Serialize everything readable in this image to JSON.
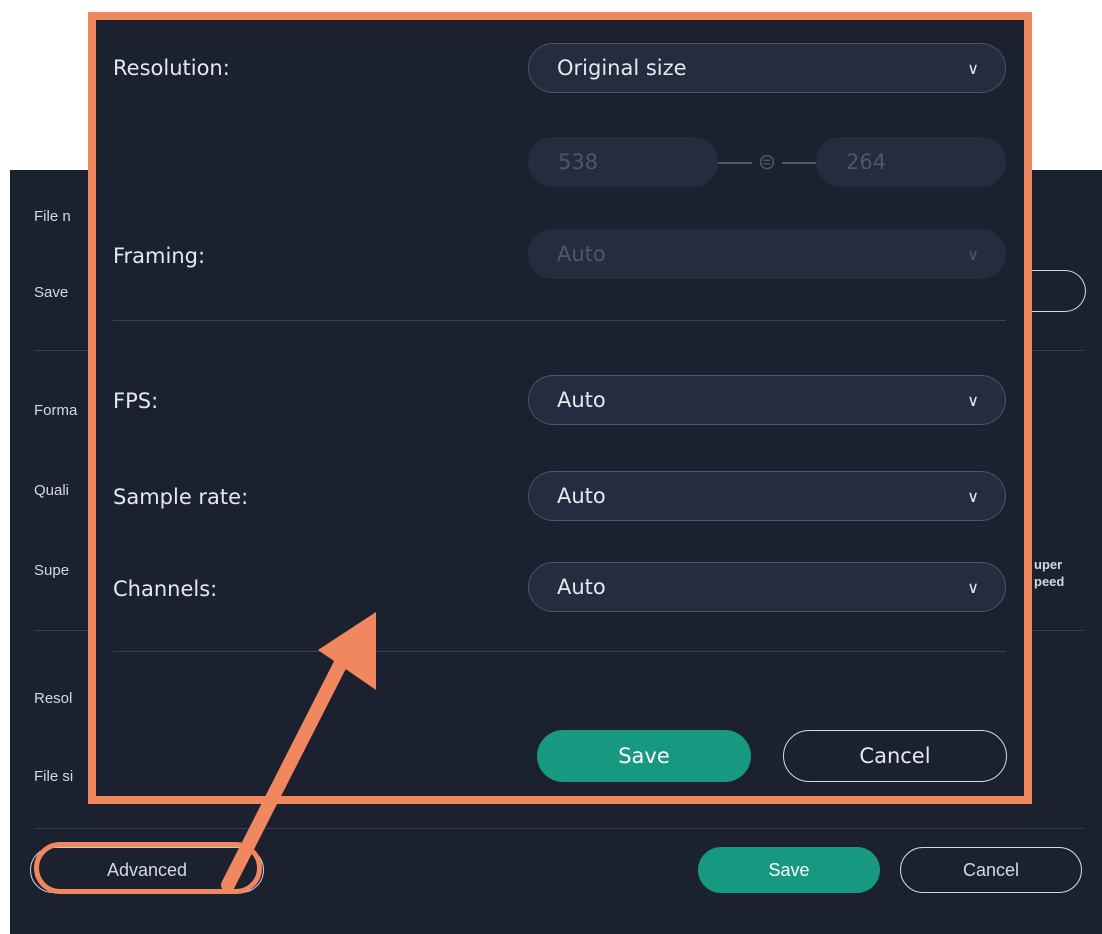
{
  "background": {
    "labels": {
      "file_name": "File n",
      "save": "Save",
      "format": "Forma",
      "quality": "Quali",
      "super": "Supe",
      "resolution": "Resol",
      "file_size": "File si"
    },
    "super_speed": [
      "uper",
      "peed"
    ],
    "save_label": "Save",
    "cancel_label": "Cancel",
    "advanced_label": "Advanced"
  },
  "popup": {
    "resolution": {
      "label": "Resolution:",
      "value": "Original size"
    },
    "width_value": "538",
    "height_value": "264",
    "framing": {
      "label": "Framing:",
      "value": "Auto"
    },
    "fps": {
      "label": "FPS:",
      "value": "Auto"
    },
    "sample_rate": {
      "label": "Sample rate:",
      "value": "Auto"
    },
    "channels": {
      "label": "Channels:",
      "value": "Auto"
    },
    "save_label": "Save",
    "cancel_label": "Cancel"
  },
  "colors": {
    "panel_bg": "#1c2130",
    "field_bg": "#262c3f",
    "accent_green": "#179881",
    "highlight_orange": "#f0875f",
    "text": "#e6e8ee",
    "disabled_text": "#4e566c"
  },
  "icons": {
    "dropdown": "chevron-down-icon",
    "link": "link-icon",
    "annotation": "arrow-icon"
  }
}
